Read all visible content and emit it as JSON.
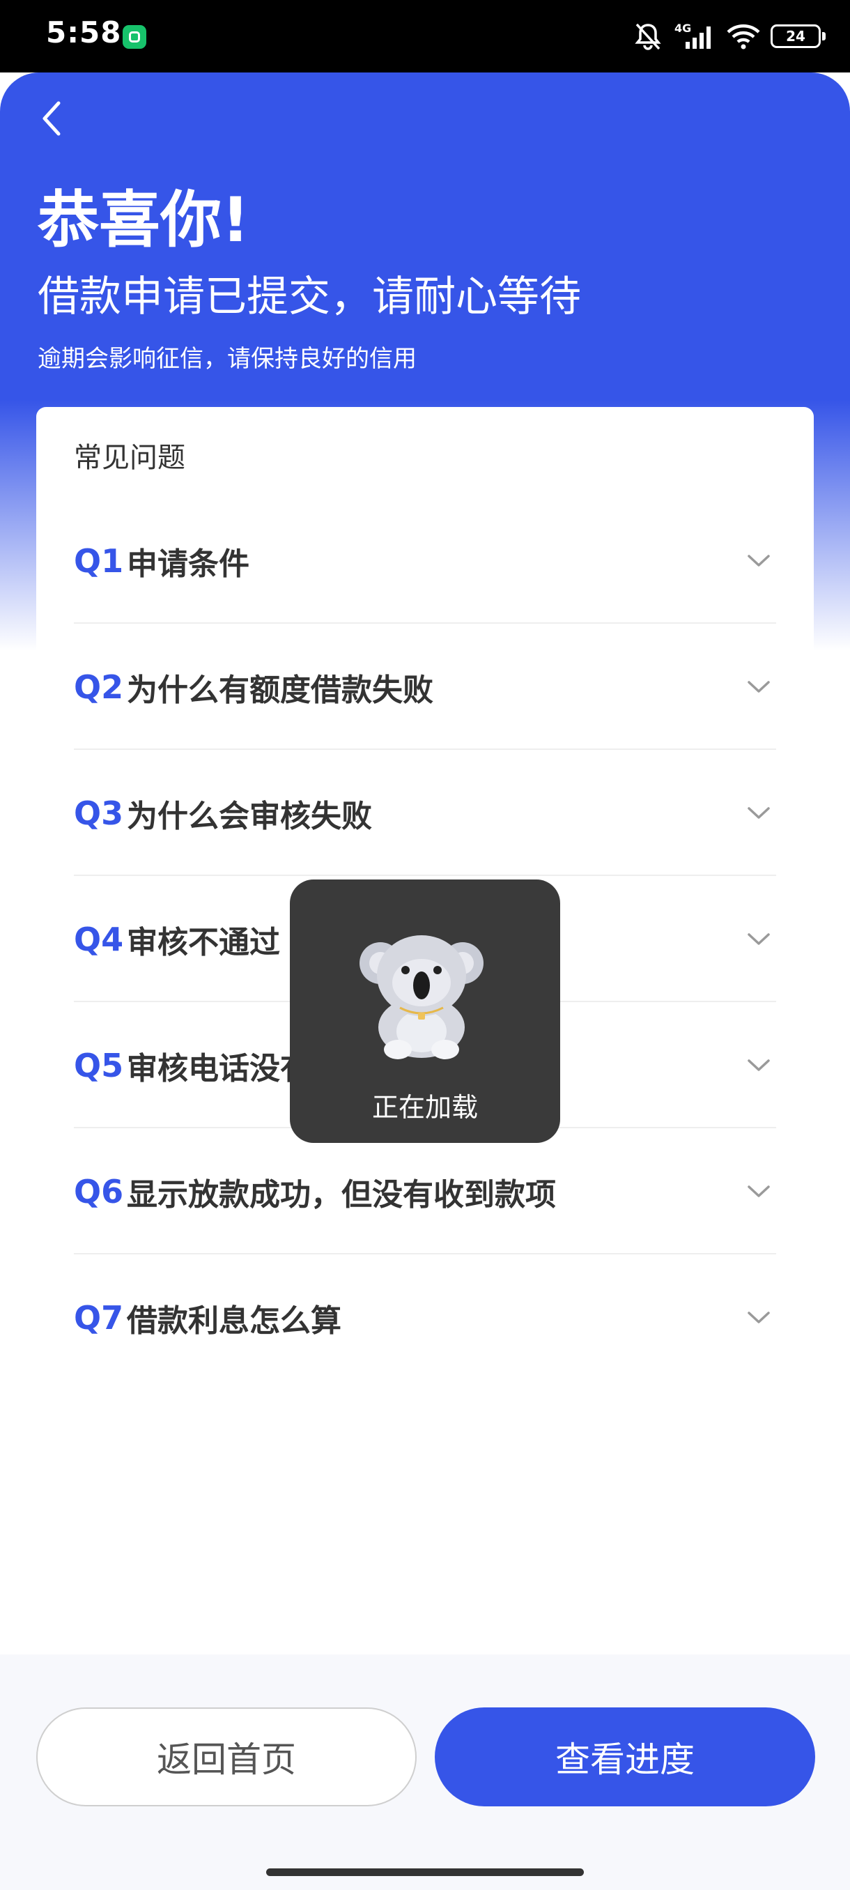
{
  "status_bar": {
    "time": "5:58",
    "network": "4G",
    "battery": "24"
  },
  "header": {
    "title": "恭喜你!",
    "subtitle": "借款申请已提交，请耐心等待",
    "note": "逾期会影响征信，请保持良好的信用"
  },
  "faq": {
    "heading": "常见问题",
    "items": [
      {
        "no": "Q1",
        "text": "申请条件"
      },
      {
        "no": "Q2",
        "text": "为什么有额度借款失败"
      },
      {
        "no": "Q3",
        "text": "为什么会审核失败"
      },
      {
        "no": "Q4",
        "text": "审核不通过"
      },
      {
        "no": "Q5",
        "text": "审核电话没有接到"
      },
      {
        "no": "Q6",
        "text": "显示放款成功，但没有收到款项"
      },
      {
        "no": "Q7",
        "text": "借款利息怎么算"
      }
    ]
  },
  "buttons": {
    "home": "返回首页",
    "progress": "查看进度"
  },
  "loading": {
    "text": "正在加载"
  },
  "colors": {
    "primary": "#3655e8",
    "text": "#333333"
  }
}
